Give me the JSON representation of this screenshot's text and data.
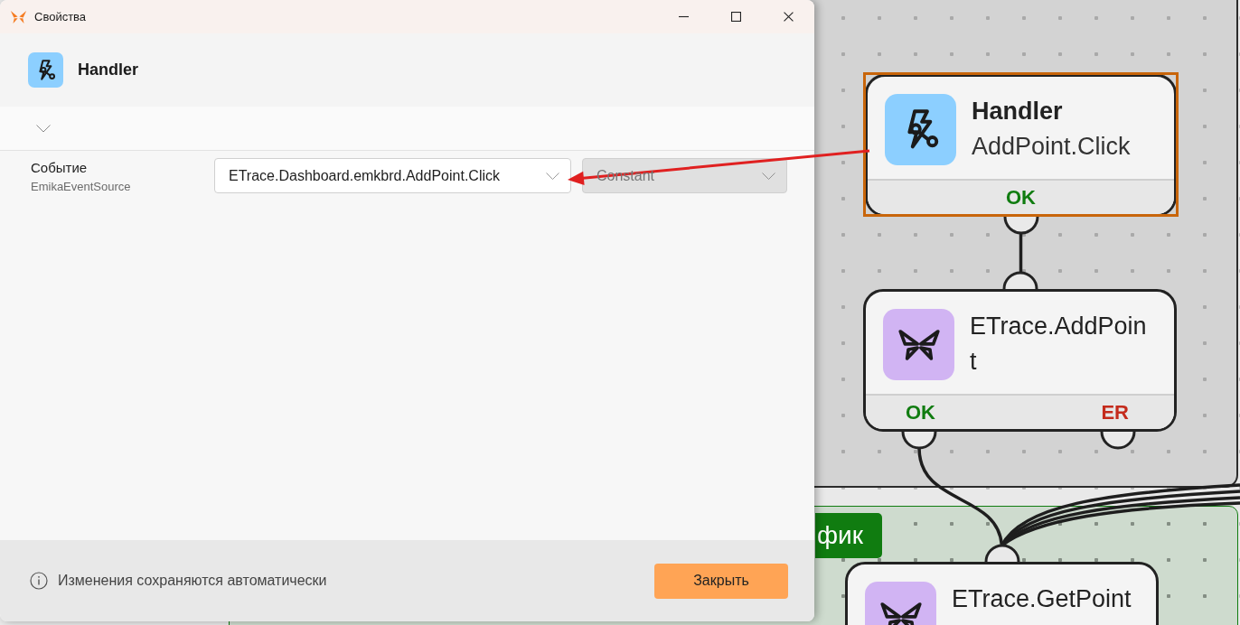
{
  "window": {
    "title": "Свойства"
  },
  "header": {
    "kind": "handler",
    "title": "Handler"
  },
  "fields": [
    {
      "label": "Событие",
      "source": "EmikaEventSource",
      "value": "ETrace.Dashboard.emkbrd.AddPoint.Click",
      "mode": {
        "value": "Constant",
        "disabled": true
      }
    }
  ],
  "footer": {
    "note": "Изменения сохраняются автоматически",
    "button": "Закрыть"
  },
  "canvas": {
    "groups": [
      {
        "label": "фик",
        "color": "#107c10"
      }
    ],
    "nodes": [
      {
        "kind": "handler",
        "title": "Handler",
        "subtitle": "AddPoint.Click",
        "selected": true,
        "outputs": [
          {
            "kind": "ok",
            "label": "OK"
          }
        ]
      },
      {
        "kind": "action",
        "title": "ETrace.AddPoint",
        "selected": false,
        "outputs": [
          {
            "kind": "ok",
            "label": "OK"
          },
          {
            "kind": "error",
            "label": "ER"
          }
        ]
      },
      {
        "kind": "action",
        "title": "ETrace.GetPoint",
        "selected": false
      }
    ]
  }
}
